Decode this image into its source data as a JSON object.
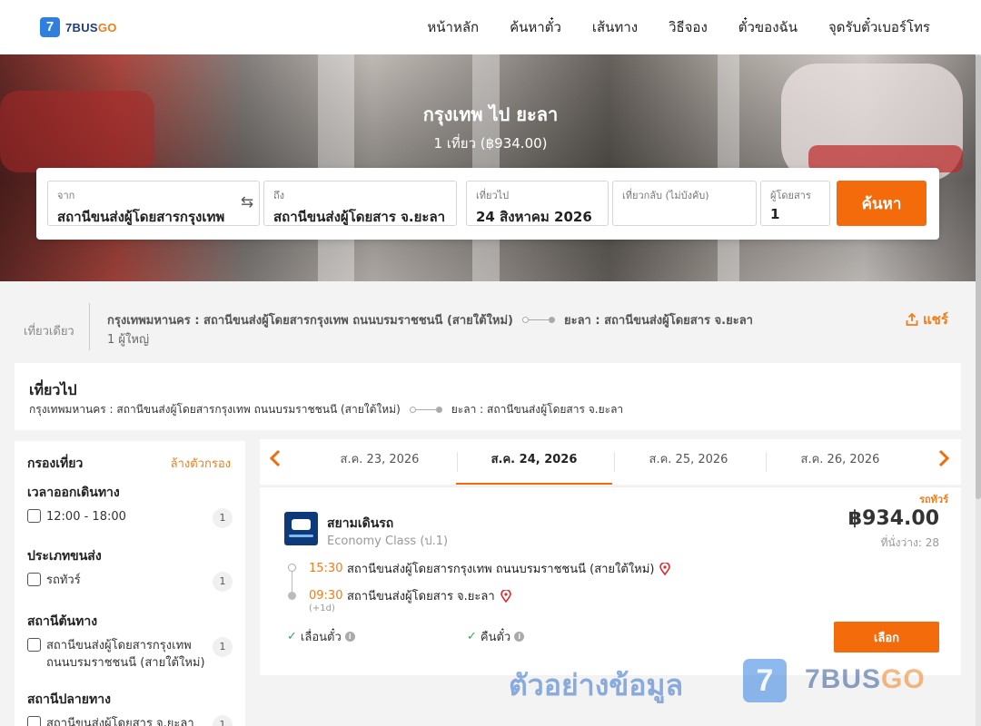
{
  "brand": {
    "mark": "7",
    "name_a": "7BUS",
    "name_b": "GO"
  },
  "nav": [
    "หน้าหลัก",
    "ค้นหาตั๋ว",
    "เส้นทาง",
    "วิธีจอง",
    "ตั๋วของฉัน",
    "จุดรับตั๋วเบอร์โทร"
  ],
  "hero": {
    "title": "กรุงเทพ ไป ยะลา",
    "subtitle": "1 เที่ยว (฿934.00)"
  },
  "search": {
    "from_label": "จาก",
    "from_value": "สถานีขนส่งผู้โดยสารกรุงเทพ",
    "swap_icon": "⇆",
    "to_label": "ถึง",
    "to_value": "สถานีขนส่งผู้โดยสาร จ.ยะลา",
    "depart_label": "เที่ยวไป",
    "depart_value": "24 สิงหาคม 2026",
    "return_label": "เที่ยวกลับ (ไม่บังคับ)",
    "return_value": "",
    "pax_label": "ผู้โดยสาร",
    "pax_value": "1",
    "button": "ค้นหา"
  },
  "summary": {
    "trip_type": "เที่ยวเดียว",
    "origin": "กรุงเทพมหานคร : สถานีขนส่งผู้โดยสารกรุงเทพ ถนนบรมราชชนนี (สายใต้ใหม่)",
    "destination": "ยะลา : สถานีขนส่งผู้โดยสาร จ.ยะลา",
    "passengers": "1 ผู้ใหญ่",
    "share": "แชร์"
  },
  "outbound": {
    "title": "เที่ยวไป",
    "origin": "กรุงเทพมหานคร : สถานีขนส่งผู้โดยสารกรุงเทพ ถนนบรมราชชนนี (สายใต้ใหม่)",
    "destination": "ยะลา : สถานีขนส่งผู้โดยสาร จ.ยะลา"
  },
  "filters": {
    "title": "กรองเที่ยว",
    "clear": "ล้างตัวกรอง",
    "sections": [
      {
        "title": "เวลาออกเดินทาง",
        "options": [
          {
            "label": "12:00 - 18:00",
            "count": "1"
          }
        ]
      },
      {
        "title": "ประเภทขนส่ง",
        "options": [
          {
            "label": "รถทัวร์",
            "count": "1"
          }
        ]
      },
      {
        "title": "สถานีต้นทาง",
        "options": [
          {
            "label": "สถานีขนส่งผู้โดยสารกรุงเทพ ถนนบรมราชชนนี (สายใต้ใหม่)",
            "count": "1"
          }
        ]
      },
      {
        "title": "สถานีปลายทาง",
        "options": [
          {
            "label": "สถานีขนส่งผู้โดยสาร จ.ยะลา",
            "count": "1"
          }
        ]
      }
    ]
  },
  "dates": {
    "prev_icon": "‹",
    "next_icon": "›",
    "tabs": [
      "ส.ค. 23, 2026",
      "ส.ค. 24, 2026",
      "ส.ค. 25, 2026",
      "ส.ค. 26, 2026"
    ],
    "active_index": 1
  },
  "result": {
    "tag": "รถทัวร์",
    "operator": "สยามเดินรถ",
    "class": "Economy Class (ป.1)",
    "price": "฿934.00",
    "seats": "ที่นั่งว่าง: 28",
    "depart_time": "15:30",
    "depart_station": "สถานีขนส่งผู้โดยสารกรุงเทพ ถนนบรมราชชนนี (สายใต้ใหม่)",
    "arrive_time": "09:30",
    "arrive_station": "สถานีขนส่งผู้โดยสาร จ.ยะลา",
    "plus_day": "(+1d)",
    "feature_1": "เลื่อนตั๋ว",
    "feature_2": "คืนตั๋ว",
    "check_icon": "✓",
    "info_icon": "i",
    "select": "เลือก"
  },
  "watermark": {
    "text": "ตัวอย่างข้อมูล",
    "mark": "7",
    "brand_a": "7BUS",
    "brand_b": "GO"
  },
  "colors": {
    "accent": "#f46b0c",
    "brand_blue": "#2f7fe0",
    "check": "#3aa655"
  }
}
